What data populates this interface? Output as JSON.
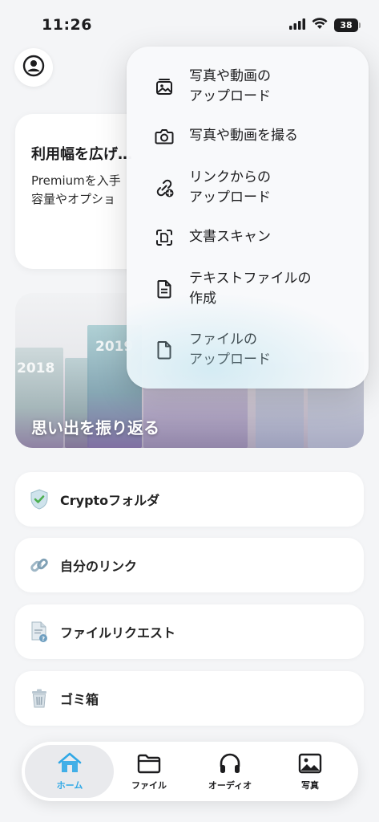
{
  "status_bar": {
    "time": "11:26",
    "battery": "38",
    "icons": [
      "signal-icon",
      "wifi-icon",
      "battery-icon"
    ]
  },
  "promo": {
    "title": "利用幅を広げ…",
    "line1": "Premiumを入手",
    "line2": "容量やオプショ"
  },
  "memories": {
    "title": "思い出を振り返る",
    "years": [
      "2018",
      "2019"
    ]
  },
  "list": [
    {
      "label": "Cryptoフォルダ",
      "icon": "shield-check-icon"
    },
    {
      "label": "自分のリンク",
      "icon": "chain-link-icon"
    },
    {
      "label": "ファイルリクエスト",
      "icon": "file-request-icon"
    },
    {
      "label": "ゴミ箱",
      "icon": "trash-icon"
    }
  ],
  "menu": {
    "items": [
      {
        "line1": "写真や動画の",
        "line2": "アップロード",
        "icon": "photo-upload-icon"
      },
      {
        "line1": "写真や動画を撮る",
        "line2": "",
        "icon": "camera-icon"
      },
      {
        "line1": "リンクからの",
        "line2": "アップロード",
        "icon": "link-add-icon"
      },
      {
        "line1": "文書スキャン",
        "line2": "",
        "icon": "scan-document-icon"
      },
      {
        "line1": "テキストファイルの",
        "line2": "作成",
        "icon": "text-file-icon"
      },
      {
        "line1": "ファイルの",
        "line2": "アップロード",
        "icon": "file-upload-icon"
      }
    ]
  },
  "tabs": [
    {
      "label": "ホーム",
      "icon": "home-icon",
      "active": true
    },
    {
      "label": "ファイル",
      "icon": "folder-icon",
      "active": false
    },
    {
      "label": "オーディオ",
      "icon": "headphones-icon",
      "active": false
    },
    {
      "label": "写真",
      "icon": "image-icon",
      "active": false
    }
  ],
  "colors": {
    "accent": "#30a8e6",
    "background": "#f4f5f7",
    "card": "#ffffff"
  }
}
